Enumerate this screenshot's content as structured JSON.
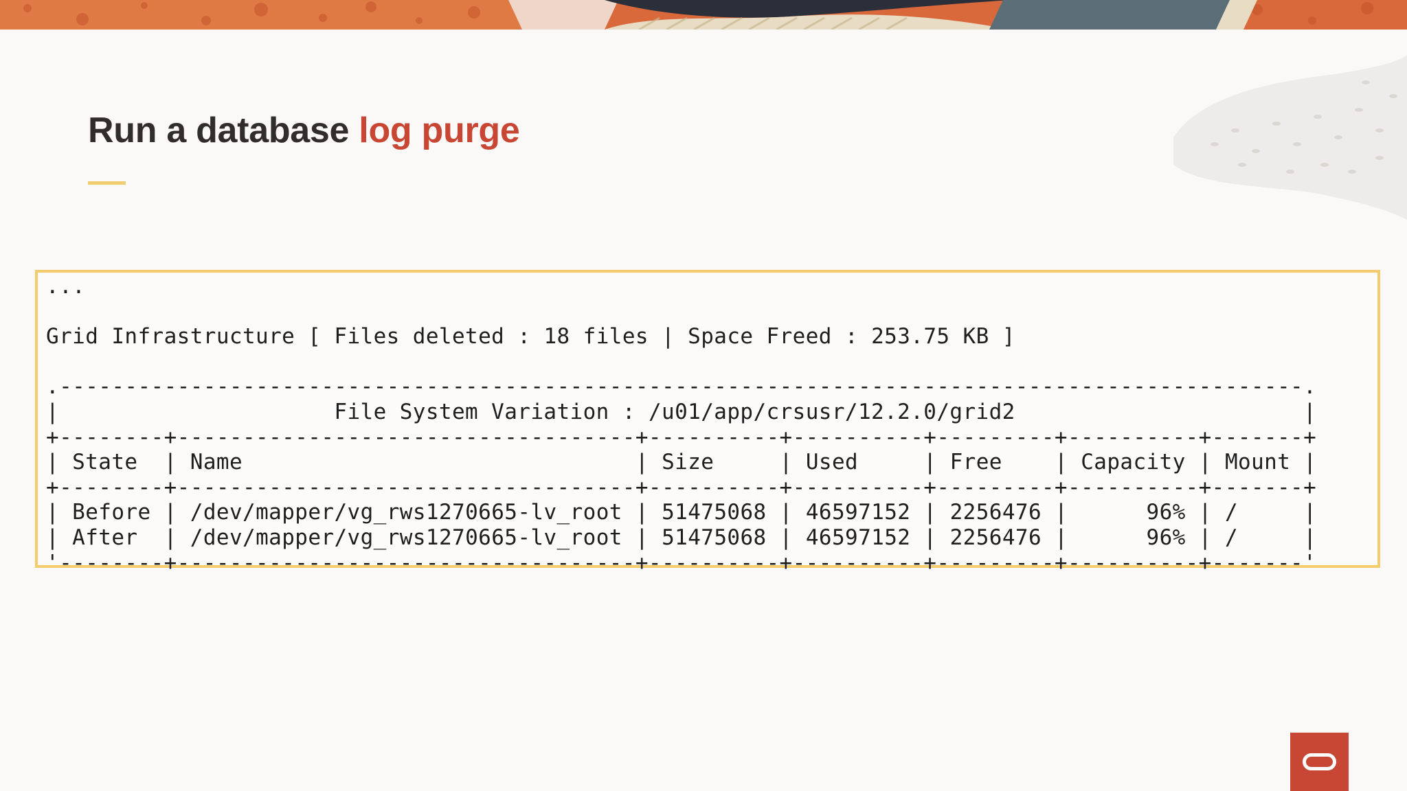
{
  "slide": {
    "title_prefix": "Run a database ",
    "title_highlight": "log purge"
  },
  "terminal": {
    "ellipsis": "...",
    "summary": {
      "component": "Grid Infrastructure",
      "files_deleted_label": "Files deleted",
      "files_deleted_value": "18 files",
      "space_freed_label": "Space Freed",
      "space_freed_value": "253.75 KB"
    },
    "table": {
      "title_label": "File System Variation",
      "title_path": "/u01/app/crsusr/12.2.0/grid2",
      "columns": [
        "State",
        "Name",
        "Size",
        "Used",
        "Free",
        "Capacity",
        "Mount"
      ],
      "rows": [
        [
          "Before",
          "/dev/mapper/vg_rws1270665-lv_root",
          "51475068",
          "46597152",
          "2256476",
          "96%",
          "/"
        ],
        [
          "After",
          "/dev/mapper/vg_rws1270665-lv_root",
          "51475068",
          "46597152",
          "2256476",
          "96%",
          "/"
        ]
      ]
    }
  },
  "colors": {
    "accent_red": "#c74634",
    "title_dark": "#312d2a",
    "highlight_border": "#f5cc6c",
    "rule_yellow": "#f0cc71"
  },
  "icons": {
    "brand_logo": "oracle-logo-icon"
  }
}
